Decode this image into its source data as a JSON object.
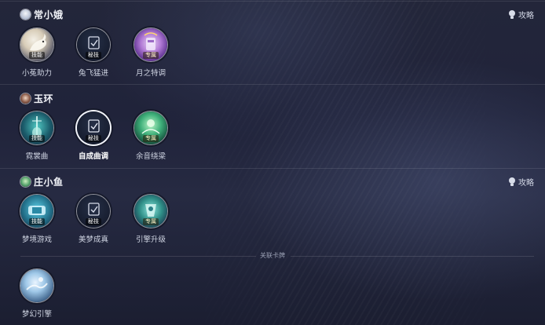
{
  "characters": [
    {
      "name": "常小娥",
      "guide_label": "攻略",
      "skills": [
        {
          "tag": "技能",
          "label": "小菟助力",
          "icon": "rabbit-icon"
        },
        {
          "tag": "秘技",
          "label": "兔飞猛进",
          "icon": "card-icon"
        },
        {
          "tag": "专属",
          "label": "月之特调",
          "icon": "moon-drink-icon"
        }
      ]
    },
    {
      "name": "玉环",
      "skills": [
        {
          "tag": "技能",
          "label": "霓裳曲",
          "icon": "pipa-icon"
        },
        {
          "tag": "秘技",
          "label": "自成曲调",
          "icon": "card-icon"
        },
        {
          "tag": "专属",
          "label": "余音绕梁",
          "icon": "spirit-icon"
        }
      ]
    },
    {
      "name": "庄小鱼",
      "guide_label": "攻略",
      "skills": [
        {
          "tag": "技能",
          "label": "梦境游戏",
          "icon": "game-console-icon"
        },
        {
          "tag": "秘技",
          "label": "美梦成真",
          "icon": "card-icon"
        },
        {
          "tag": "专属",
          "label": "引擎升级",
          "icon": "engine-icon"
        }
      ]
    }
  ],
  "linked_cards": {
    "divider_label": "关联卡牌",
    "cards": [
      {
        "label": "梦幻引擎",
        "icon": "dream-engine-card-icon"
      }
    ]
  },
  "colors": {
    "background": "#22253a",
    "text": "#e6e9f2",
    "divider": "#3a3e55"
  }
}
